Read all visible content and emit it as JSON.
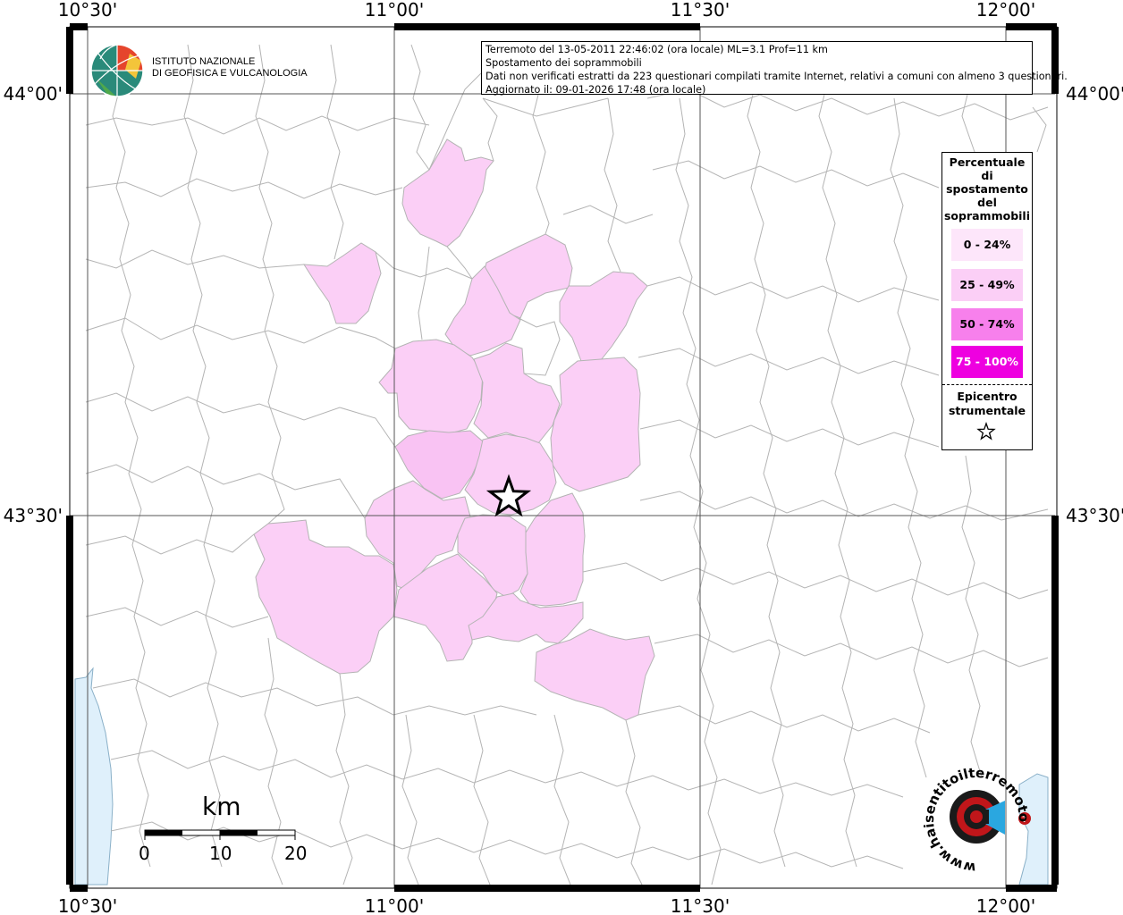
{
  "info": {
    "line1": "Terremoto del 13-05-2011 22:46:02 (ora locale) ML=3.1 Prof=11 km",
    "line2": "Spostamento dei soprammobili",
    "line3": "Dati non verificati estratti da 223 questionari compilati tramite Internet, relativi a comuni con almeno 3 questionari.",
    "line4": "Aggiornato il: 09-01-2026 17:48 (ora locale)"
  },
  "axes": {
    "lon_labels": [
      "10°30'",
      "11°00'",
      "11°30'",
      "12°00'"
    ],
    "lat_labels": [
      "44°00'",
      "43°30'"
    ]
  },
  "legend": {
    "title_lines": [
      "Percentuale",
      "di",
      "spostamento",
      "del",
      "soprammobili"
    ],
    "classes": [
      {
        "label": "0 - 24%",
        "color": "#fde6fa"
      },
      {
        "label": "25 - 49%",
        "color": "#fbcff6"
      },
      {
        "label": "50 - 74%",
        "color": "#f780ec"
      },
      {
        "label": "75 - 100%",
        "color": "#ee00e0"
      }
    ],
    "epicenter_lines": [
      "Epicentro",
      "strumentale"
    ],
    "epicenter_icon": "star-icon"
  },
  "logo": {
    "line1": "ISTITUTO NAZIONALE",
    "line2": "DI GEOFISICA E VULCANOLOGIA",
    "icon": "globe-icon"
  },
  "scale": {
    "unit": "km",
    "labels": [
      "0",
      "10",
      "20"
    ]
  },
  "watermark": {
    "text": "www.haisentitoilterremoto.it",
    "icon": "speaker-target-icon"
  },
  "colors": {
    "sea": "#dff0fb",
    "border": "#b4b4b4",
    "frame": "#000000"
  }
}
